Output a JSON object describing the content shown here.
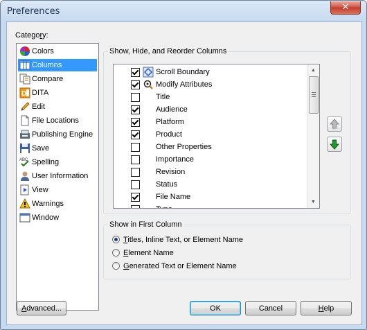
{
  "window": {
    "title": "Preferences",
    "close_glyph": "✕"
  },
  "category": {
    "label_prefix": "Catego",
    "label_accel": "r",
    "label_suffix": "y:",
    "items": [
      {
        "label": "Colors",
        "icon": "colors-icon"
      },
      {
        "label": "Columns",
        "icon": "columns-icon",
        "selected": true
      },
      {
        "label": "Compare",
        "icon": "compare-icon"
      },
      {
        "label": "DITA",
        "icon": "dita-icon"
      },
      {
        "label": "Edit",
        "icon": "edit-icon"
      },
      {
        "label": "File Locations",
        "icon": "file-locations-icon"
      },
      {
        "label": "Publishing Engine",
        "icon": "publishing-engine-icon"
      },
      {
        "label": "Save",
        "icon": "save-icon"
      },
      {
        "label": "Spelling",
        "icon": "spelling-icon"
      },
      {
        "label": "User Information",
        "icon": "user-information-icon"
      },
      {
        "label": "View",
        "icon": "view-icon"
      },
      {
        "label": "Warnings",
        "icon": "warnings-icon"
      },
      {
        "label": "Window",
        "icon": "window-icon"
      }
    ]
  },
  "columns_group": {
    "title": "Show, Hide, and Reorder Columns",
    "items": [
      {
        "label": "Scroll Boundary",
        "checked": true,
        "icon": "scroll-boundary-icon"
      },
      {
        "label": "Modify Attributes",
        "checked": true,
        "icon": "modify-attributes-icon"
      },
      {
        "label": "Title",
        "checked": false
      },
      {
        "label": "Audience",
        "checked": true
      },
      {
        "label": "Platform",
        "checked": true
      },
      {
        "label": "Product",
        "checked": true
      },
      {
        "label": "Other Properties",
        "checked": false
      },
      {
        "label": "Importance",
        "checked": false
      },
      {
        "label": "Revision",
        "checked": false
      },
      {
        "label": "Status",
        "checked": false
      },
      {
        "label": "File Name",
        "checked": true
      },
      {
        "label": "Type",
        "checked": false
      }
    ],
    "move_up_icon": "arrow-up-icon",
    "move_down_icon": "arrow-down-icon"
  },
  "first_column_group": {
    "title": "Show in First Column",
    "options": [
      {
        "accel": "T",
        "rest": "itles, Inline Text, or Element Name",
        "selected": true
      },
      {
        "accel": "E",
        "rest": "lement Name",
        "selected": false
      },
      {
        "accel": "G",
        "rest": "enerated Text or Element Name",
        "selected": false
      }
    ]
  },
  "buttons": {
    "advanced": {
      "accel": "A",
      "rest": "dvanced..."
    },
    "ok": "OK",
    "cancel": "Cancel",
    "help": {
      "accel": "H",
      "rest": "elp"
    }
  }
}
